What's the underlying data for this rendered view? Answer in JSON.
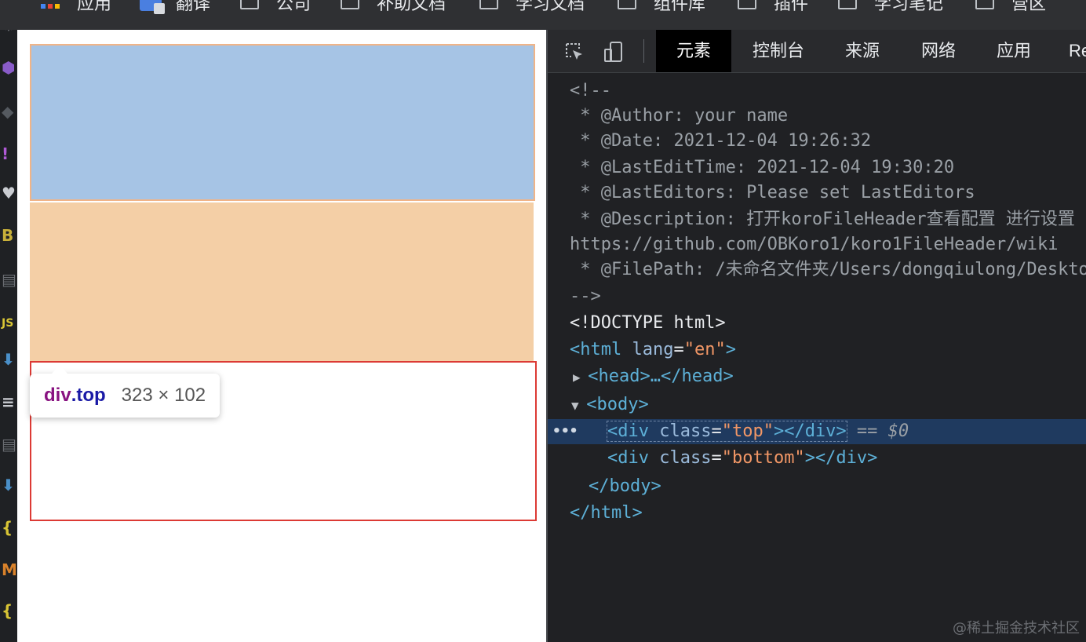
{
  "bookmarks": [
    {
      "icon": "apps-grid-icon",
      "label": "应用"
    },
    {
      "icon": "translate-icon",
      "label": "翻译"
    },
    {
      "icon": "folder-icon",
      "label": "公司"
    },
    {
      "icon": "folder-icon",
      "label": "补助文档"
    },
    {
      "icon": "folder-icon",
      "label": "学习文档"
    },
    {
      "icon": "folder-icon",
      "label": "组件库"
    },
    {
      "icon": "folder-icon",
      "label": "插件"
    },
    {
      "icon": "folder-icon",
      "label": "学习笔记"
    },
    {
      "icon": "folder-icon",
      "label": "营区"
    }
  ],
  "editor_strip": {
    "icons": [
      {
        "glyph": "⚙",
        "color": "#6b6e73"
      },
      {
        "glyph": "⬢",
        "color": "#8a5cc9"
      },
      {
        "glyph": "◆",
        "color": "#555a60"
      },
      {
        "glyph": "!",
        "color": "#b05ad6"
      },
      {
        "glyph": "♥",
        "color": "#c9ccd1"
      },
      {
        "glyph": "B",
        "color": "#c9b13a"
      },
      {
        "glyph": "▤",
        "color": "#6b6e73"
      },
      {
        "glyph": "JS",
        "color": "#d8c535"
      },
      {
        "glyph": "⬇",
        "color": "#4a90c9"
      },
      {
        "glyph": "≡",
        "color": "#c9ccd1"
      },
      {
        "glyph": "▤",
        "color": "#6b6e73"
      },
      {
        "glyph": "⬇",
        "color": "#4a90c9"
      },
      {
        "glyph": "{",
        "color": "#d8c535"
      },
      {
        "glyph": "M",
        "color": "#d9822b"
      },
      {
        "glyph": "{",
        "color": "#d8c535"
      }
    ]
  },
  "viewport": {
    "tooltip": {
      "tag": "div",
      "class": ".top",
      "size": "323 × 102"
    }
  },
  "devtools": {
    "tabs": [
      "元素",
      "控制台",
      "来源",
      "网络",
      "应用",
      "Re"
    ],
    "active_tab": "元素",
    "lines": [
      {
        "kind": "comment",
        "text": "<!--"
      },
      {
        "kind": "comment",
        "text": " * @Author: your name"
      },
      {
        "kind": "comment",
        "text": " * @Date: 2021-12-04 19:26:32"
      },
      {
        "kind": "comment",
        "text": " * @LastEditTime: 2021-12-04 19:30:20"
      },
      {
        "kind": "comment",
        "text": " * @LastEditors: Please set LastEditors"
      },
      {
        "kind": "comment",
        "text": " * @Description: 打开koroFileHeader查看配置 进行设置"
      },
      {
        "kind": "comment",
        "text": "https://github.com/OBKoro1/koro1FileHeader/wiki"
      },
      {
        "kind": "comment",
        "text": " * @FilePath: /未命名文件夹/Users/dongqiulong/Desktop"
      },
      {
        "kind": "comment",
        "text": "-->"
      },
      {
        "kind": "doctype",
        "text": "<!DOCTYPE html>"
      },
      {
        "kind": "html_open",
        "tag": "<html",
        "attr": "lang",
        "value": "\"en\"",
        "close": ">"
      },
      {
        "kind": "head",
        "text": "<head>…</head>"
      },
      {
        "kind": "body_open",
        "text": "<body>"
      },
      {
        "kind": "div",
        "attr": "class",
        "value": "\"top\"",
        "suffix": " == $0"
      },
      {
        "kind": "div",
        "attr": "class",
        "value": "\"bottom\"",
        "suffix": ""
      },
      {
        "kind": "body_close",
        "text": "</body>"
      },
      {
        "kind": "html_close",
        "text": "</html>"
      }
    ]
  },
  "watermark": "@稀土掘金技术社区"
}
